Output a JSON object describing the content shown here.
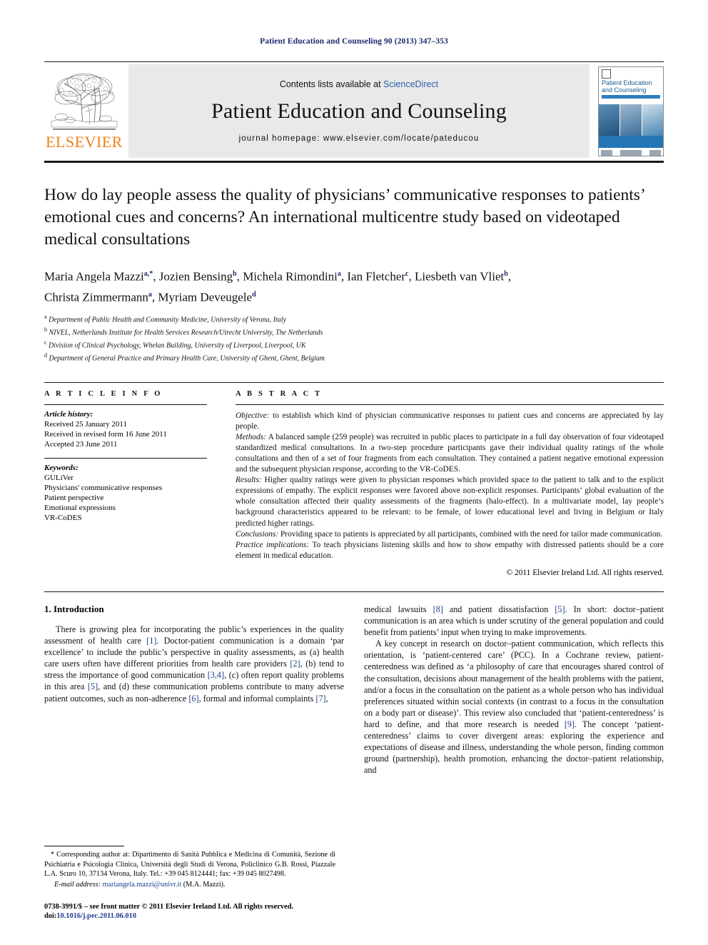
{
  "running_head": "Patient Education and Counseling 90 (2013) 347–353",
  "masthead": {
    "contents_prefix": "Contents lists available at",
    "sciencedirect": "ScienceDirect",
    "journal_title": "Patient Education and Counseling",
    "homepage": "journal homepage: www.elsevier.com/locate/pateducou",
    "publisher_word": "ELSEVIER",
    "cover_title": "Patient Education and Counseling"
  },
  "article": {
    "title": "How do lay people assess the quality of physicians’ communicative responses to patients’ emotional cues and concerns? An international multicentre study based on videotaped medical consultations",
    "authors": "Maria Angela Mazzi a,*, Jozien Bensing b, Michela Rimondini a, Ian Fletcher c, Liesbeth van Vliet b, Christa Zimmermann a, Myriam Deveugele d",
    "affiliations": [
      {
        "marker": "a",
        "text": "Department of Public Health and Community Medicine, University of Verona, Italy"
      },
      {
        "marker": "b",
        "text": "NIVEL, Netherlands Institute for Health Services Research/Utrecht University, The Netherlands"
      },
      {
        "marker": "c",
        "text": "Division of Clinical Psychology, Whelan Building, University of Liverpool, Liverpool, UK"
      },
      {
        "marker": "d",
        "text": "Department of General Practice and Primary Health Care, University of Ghent, Ghent, Belgium"
      }
    ]
  },
  "article_info": {
    "heading": "A R T I C L E   I N F O",
    "history_label": "Article history:",
    "history": [
      "Received 25 January 2011",
      "Received in revised form 16 June 2011",
      "Accepted 23 June 2011"
    ],
    "keywords_label": "Keywords:",
    "keywords": [
      "GULiVer",
      "Physicians' communicative responses",
      "Patient perspective",
      "Emotional expressions",
      "VR-CoDES"
    ]
  },
  "abstract": {
    "heading": "A B S T R A C T",
    "sections": [
      {
        "label": "Objective:",
        "text": " to establish which kind of physician communicative responses to patient cues and concerns are appreciated by lay people."
      },
      {
        "label": "Methods:",
        "text": " A balanced sample (259 people) was recruited in public places to participate in a full day observation of four videotaped standardized medical consultations. In a two-step procedure participants gave their individual quality ratings of the whole consultations and then of a set of four fragments from each consultation. They contained a patient negative emotional expression and the subsequent physician response, according to the VR-CoDES."
      },
      {
        "label": "Results:",
        "text": " Higher quality ratings were given to physician responses which provided space to the patient to talk and to the explicit expressions of empathy. The explicit responses were favored above non-explicit responses. Participants’ global evaluation of the whole consultation affected their quality assessments of the fragments (halo-effect). In a multivariate model, lay people’s background characteristics appeared to be relevant: to be female, of lower educational level and living in Belgium or Italy predicted higher ratings."
      },
      {
        "label": "Conclusions:",
        "text": " Providing space to patients is appreciated by all participants, combined with the need for tailor made communication."
      },
      {
        "label": "Practice implications:",
        "text": " To teach physicians listening skills and how to show empathy with distressed patients should be a core element in medical education."
      }
    ],
    "copyright": "© 2011 Elsevier Ireland Ltd. All rights reserved."
  },
  "body": {
    "section_heading": "1. Introduction",
    "left_paragraphs": [
      "There is growing plea for incorporating the public’s experiences in the quality assessment of health care [1]. Doctor-patient communication is a domain ‘par excellence’ to include the public’s perspective in quality assessments, as (a) health care users often have different priorities from health care providers [2], (b) tend to stress the importance of good communication [3,4], (c) often report quality problems in this area [5], and (d) these communication problems contribute to many adverse patient outcomes, such as non-adherence [6], formal and informal complaints [7],"
    ],
    "right_paragraphs": [
      "medical lawsuits [8] and patient dissatisfaction [5]. In short: doctor–patient communication is an area which is under scrutiny of the general population and could benefit from patients’ input when trying to make improvements.",
      "A key concept in research on doctor–patient communication, which reflects this orientation, is ‘patient-centered care’ (PCC). In a Cochrane review, patient-centeredness was defined as ‘a philosophy of care that encourages shared control of the consultation, decisions about management of the health problems with the patient, and/or a focus in the consultation on the patient as a whole person who has individual preferences situated within social contexts (in contrast to a focus in the consultation on a body part or disease)’. This review also concluded that ‘patient-centeredness’ is hard to define, and that more research is needed [9]. The concept ‘patient-centeredness’ claims to cover divergent areas: exploring the experience and expectations of disease and illness, understanding the whole person, finding common ground (partnership), health promotion, enhancing the doctor–patient relationship, and"
    ]
  },
  "footnotes": {
    "corresponding": "* Corresponding author at: Dipartimento di Sanità Pubblica e Medicina di Comunità, Sezione di Psichiatria e Psicologia Clinica, Università degli Studi di Verona, Policlinico G.B. Rossi, Piazzale L.A. Scuro 10, 37134 Verona, Italy. Tel.: +39 045 8124441; fax: +39 045 8027498.",
    "email_label": "E-mail address:",
    "email": "mariangela.mazzi@univr.it",
    "email_suffix": "(M.A. Mazzi).",
    "issn_line": "0738-3991/$ – see front matter © 2011 Elsevier Ireland Ltd. All rights reserved.",
    "doi_label": "doi:",
    "doi": "10.1016/j.pec.2011.06.010"
  }
}
